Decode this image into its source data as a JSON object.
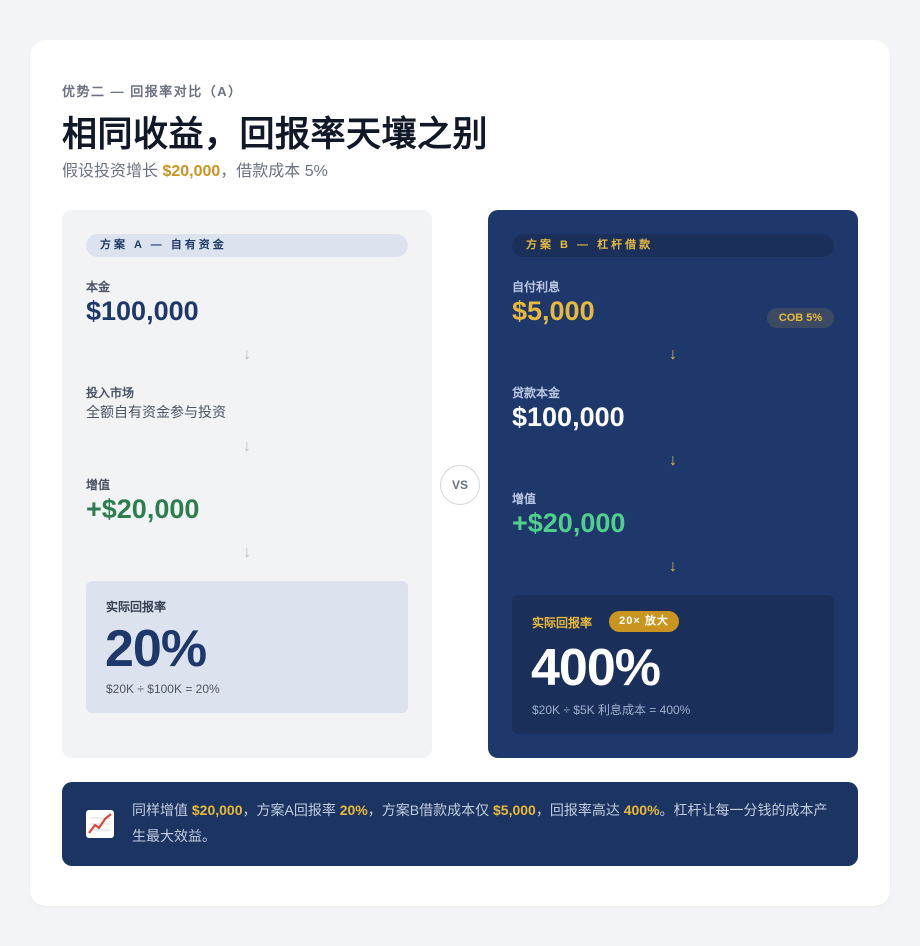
{
  "header": {
    "eyebrow": "优势二 — 回报率对比（A）",
    "title": "相同收益，回报率天壤之别",
    "subtitle_prefix": "假设投资增长 ",
    "subtitle_amount": "$20,000",
    "subtitle_suffix": "，借款成本 5%"
  },
  "plan_a": {
    "tag": "方案 A — 自有资金",
    "principal_label": "本金",
    "principal_value": "$100,000",
    "invest_label": "投入市场",
    "invest_desc": "全额自有资金参与投资",
    "gain_label": "增值",
    "gain_value": "+$20,000",
    "result_label": "实际回报率",
    "result_value": "20%",
    "result_formula": "$20K ÷ $100K = 20%",
    "arrow": "↓"
  },
  "vs_label": "VS",
  "plan_b": {
    "tag": "方案 B — 杠杆借款",
    "interest_label": "自付利息",
    "interest_value": "$5,000",
    "cob_badge": "COB 5%",
    "loan_label": "贷款本金",
    "loan_value": "$100,000",
    "gain_label": "增值",
    "gain_value": "+$20,000",
    "result_label": "实际回报率",
    "multiplier_badge": "20× 放大",
    "result_value": "400%",
    "result_formula": "$20K ÷ $5K 利息成本 = 400%",
    "arrow": "↓"
  },
  "footer": {
    "icon": "chart-increasing-icon",
    "t1": "同样增值 ",
    "v1": "$20,000",
    "t2": "，方案A回报率 ",
    "v2": "20%",
    "t3": "，方案B借款成本仅 ",
    "v3": "$5,000",
    "t4": "，回报率高达 ",
    "v4": "400%",
    "t5": "。杠杆让每一分钱的成本产生最大效益。"
  },
  "colors": {
    "navy": "#1f386b",
    "gold": "#e8b93a",
    "green_a": "#2e7d4f",
    "green_b": "#4fd18b",
    "panel_a_bg": "#f2f3f5"
  }
}
